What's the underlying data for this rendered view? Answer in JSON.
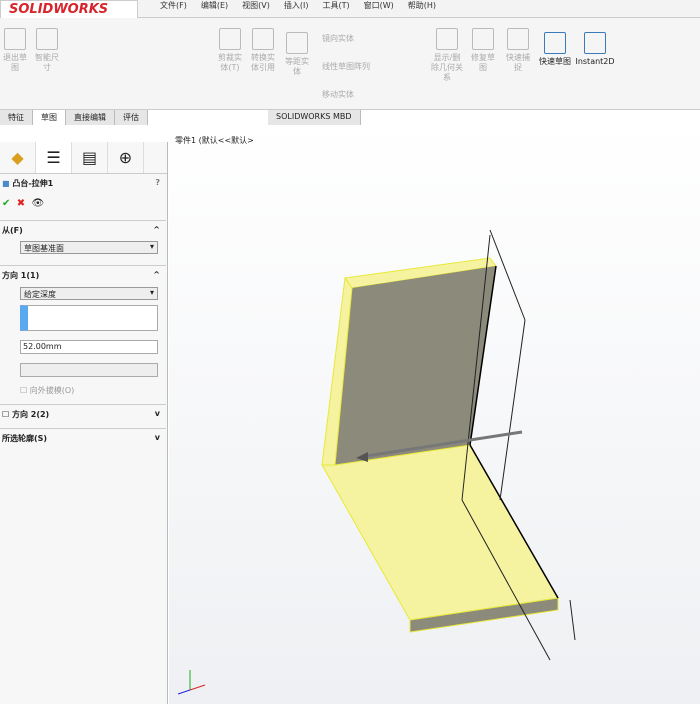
{
  "app": {
    "logo": "SOLIDWORKS",
    "menu": [
      "文件(F)",
      "编辑(E)",
      "视图(V)",
      "插入(I)",
      "工具(T)",
      "窗口(W)",
      "帮助(H)"
    ]
  },
  "ribbon": {
    "items": [
      "退出草图",
      "智能尺寸",
      "剪裁实体(T)",
      "转换实体引用",
      "等距实体",
      "镜向实体",
      "线性草图阵列",
      "移动实体",
      "显示/删除几何关系",
      "修复草图",
      "快速捕捉",
      "快速草图",
      "Instant2D"
    ]
  },
  "tabs": [
    "特征",
    "草图",
    "直接编辑",
    "评估",
    "SOLIDWORKS MBD"
  ],
  "panel": {
    "title": "凸台-拉伸1",
    "from_label": "从(F)",
    "from_value": "草图基准面",
    "dir1_label": "方向 1(1)",
    "dir1_type": "给定深度",
    "depth": "52.00mm",
    "draft_label": "向外拔模(O)",
    "dir2_label": "方向 2(2)",
    "contours_label": "所选轮廓(S)"
  },
  "viewport": {
    "tree_text": "零件1 (默认<<默认>"
  },
  "colors": {
    "face": "#f5f3a0",
    "side": "#8c8a7a",
    "edge": "#e8e83a"
  }
}
